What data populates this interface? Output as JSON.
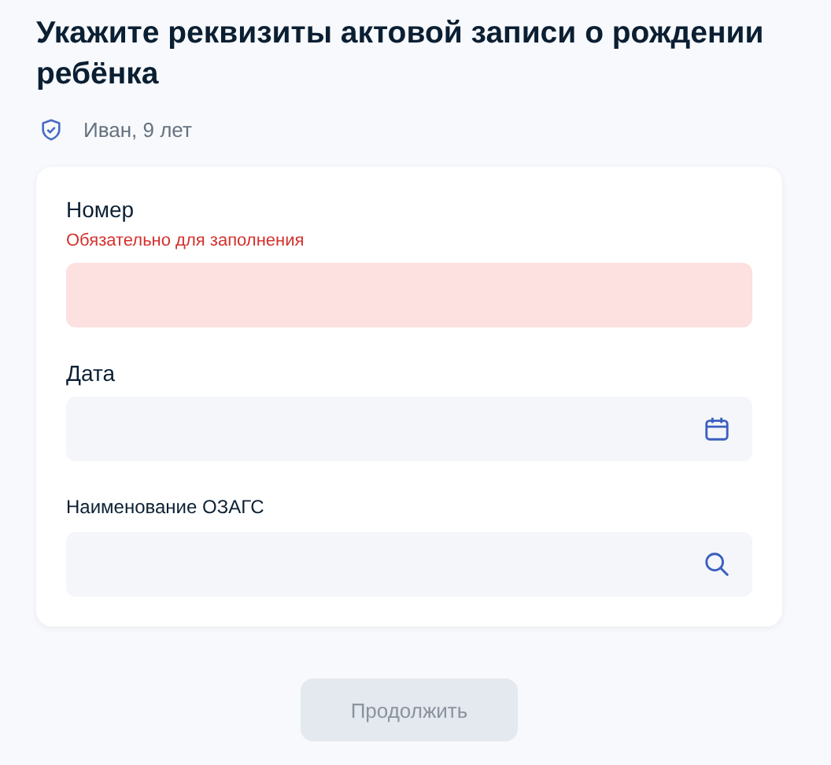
{
  "title": "Укажите реквизиты актовой записи о рождении ребёнка",
  "child": {
    "label": "Иван, 9 лет"
  },
  "fields": [
    {
      "label": "Номер",
      "kind": "text",
      "error": "Обязательно для заполнения",
      "invalid": true
    },
    {
      "label": "Дата",
      "kind": "date",
      "invalid": false
    },
    {
      "label": "Наименование ОЗАГС",
      "kind": "search",
      "invalid": false
    }
  ],
  "button": {
    "label": "Продолжить",
    "disabled": true
  }
}
